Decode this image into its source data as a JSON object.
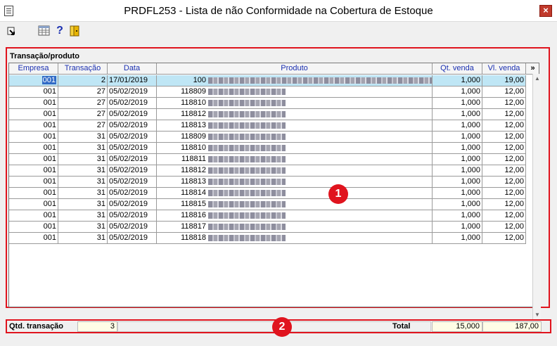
{
  "window": {
    "title": "PRDFL253 - Lista de não Conformidade na Cobertura de Estoque",
    "close_label": "×"
  },
  "toolbar": {
    "help_label": "?"
  },
  "group": {
    "label": "Transação/produto"
  },
  "table": {
    "columns": [
      "Empresa",
      "Transação",
      "Data",
      "Produto",
      "Qt. venda",
      "Vl. venda",
      "»"
    ],
    "rows": [
      {
        "empresa": "001",
        "transacao": "2",
        "data": "17/01/2019",
        "codigo": "100",
        "qt": "1,000",
        "vl": "19,00",
        "selected": true
      },
      {
        "empresa": "001",
        "transacao": "27",
        "data": "05/02/2019",
        "codigo": "118809",
        "qt": "1,000",
        "vl": "12,00"
      },
      {
        "empresa": "001",
        "transacao": "27",
        "data": "05/02/2019",
        "codigo": "118810",
        "qt": "1,000",
        "vl": "12,00"
      },
      {
        "empresa": "001",
        "transacao": "27",
        "data": "05/02/2019",
        "codigo": "118812",
        "qt": "1,000",
        "vl": "12,00"
      },
      {
        "empresa": "001",
        "transacao": "27",
        "data": "05/02/2019",
        "codigo": "118813",
        "qt": "1,000",
        "vl": "12,00"
      },
      {
        "empresa": "001",
        "transacao": "31",
        "data": "05/02/2019",
        "codigo": "118809",
        "qt": "1,000",
        "vl": "12,00"
      },
      {
        "empresa": "001",
        "transacao": "31",
        "data": "05/02/2019",
        "codigo": "118810",
        "qt": "1,000",
        "vl": "12,00"
      },
      {
        "empresa": "001",
        "transacao": "31",
        "data": "05/02/2019",
        "codigo": "118811",
        "qt": "1,000",
        "vl": "12,00"
      },
      {
        "empresa": "001",
        "transacao": "31",
        "data": "05/02/2019",
        "codigo": "118812",
        "qt": "1,000",
        "vl": "12,00"
      },
      {
        "empresa": "001",
        "transacao": "31",
        "data": "05/02/2019",
        "codigo": "118813",
        "qt": "1,000",
        "vl": "12,00"
      },
      {
        "empresa": "001",
        "transacao": "31",
        "data": "05/02/2019",
        "codigo": "118814",
        "qt": "1,000",
        "vl": "12,00"
      },
      {
        "empresa": "001",
        "transacao": "31",
        "data": "05/02/2019",
        "codigo": "118815",
        "qt": "1,000",
        "vl": "12,00"
      },
      {
        "empresa": "001",
        "transacao": "31",
        "data": "05/02/2019",
        "codigo": "118816",
        "qt": "1,000",
        "vl": "12,00"
      },
      {
        "empresa": "001",
        "transacao": "31",
        "data": "05/02/2019",
        "codigo": "118817",
        "qt": "1,000",
        "vl": "12,00"
      },
      {
        "empresa": "001",
        "transacao": "31",
        "data": "05/02/2019",
        "codigo": "118818",
        "qt": "1,000",
        "vl": "12,00"
      }
    ]
  },
  "footer": {
    "qtd_label": "Qtd. transação",
    "qtd_value": "3",
    "total_label": "Total",
    "total_qt": "15,000",
    "total_vl": "187,00"
  },
  "annotations": {
    "badge1": "1",
    "badge2": "2"
  },
  "colors": {
    "highlight": "#e0141e",
    "header_text": "#1a2fb0",
    "selected_row": "#bfe6f5"
  }
}
